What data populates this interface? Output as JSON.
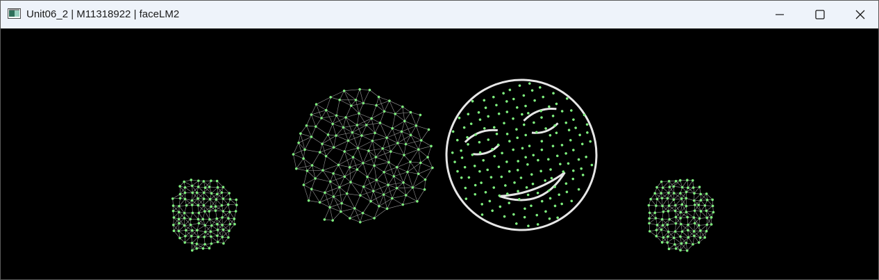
{
  "window": {
    "title": "Unit06_2 | M11318922 | faceLM2",
    "icon": "app-window-icon",
    "controls": {
      "minimize": "minimize-icon",
      "maximize": "maximize-icon",
      "close": "close-icon"
    }
  },
  "canvas": {
    "background": "#000000",
    "landmark_color": "#7ef07e",
    "mesh_line_color": "#bfbfbf",
    "contour_color": "#e6e6e6",
    "faces": [
      {
        "name": "face-small-left",
        "style": "dense-mesh"
      },
      {
        "name": "face-large-mesh",
        "style": "triangulated-wireframe"
      },
      {
        "name": "face-large-contours",
        "style": "contour-lines"
      },
      {
        "name": "face-small-right",
        "style": "dense-mesh"
      }
    ]
  }
}
